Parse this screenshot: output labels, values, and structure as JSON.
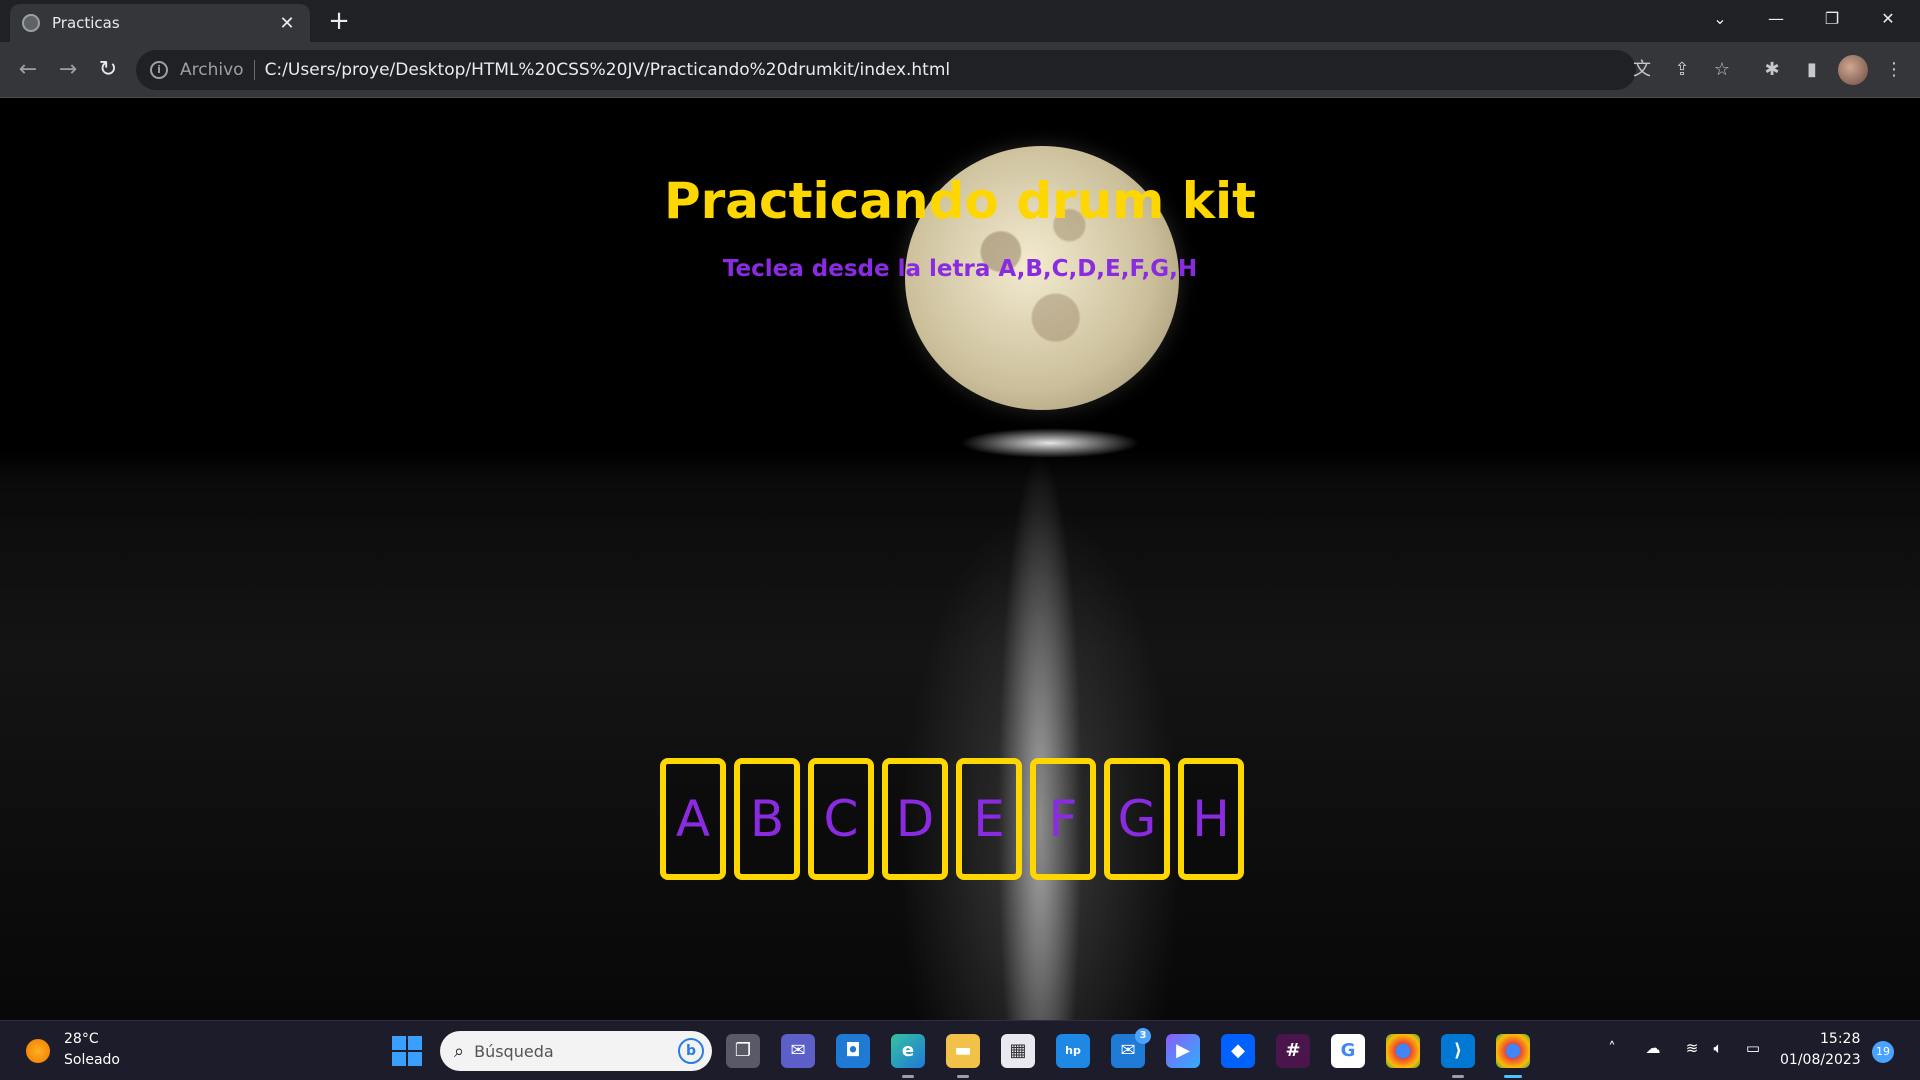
{
  "browser": {
    "tab_title": "Practicas",
    "tab_close": "✕",
    "new_tab": "+",
    "omnibox_scheme": "Archivo",
    "omnibox_url": "C:/Users/proye/Desktop/HTML%20CSS%20JV/Practicando%20drumkit/index.html"
  },
  "page": {
    "title": "Practicando drum kit",
    "subtitle": "Teclea desde la letra A,B,C,D,E,F,G,H",
    "keys": [
      "A",
      "B",
      "C",
      "D",
      "E",
      "F",
      "G",
      "H"
    ],
    "colors": {
      "title": "#ffd700",
      "subtitle": "#8a2be2",
      "key_border": "#ffd700",
      "key_text": "#8a2be2"
    }
  },
  "taskbar": {
    "weather_temp": "28°C",
    "weather_condition": "Soleado",
    "search_placeholder": "Búsqueda",
    "mail_badge": "3",
    "clock_time": "15:28",
    "clock_date": "01/08/2023",
    "notification_count": "19",
    "apps": [
      "task-view",
      "teams-chat",
      "todo",
      "edge",
      "file-explorer",
      "microsoft-store",
      "myhp",
      "mail",
      "copilot",
      "dropbox",
      "slack",
      "google",
      "chrome",
      "vscode",
      "chrome-profile"
    ]
  }
}
